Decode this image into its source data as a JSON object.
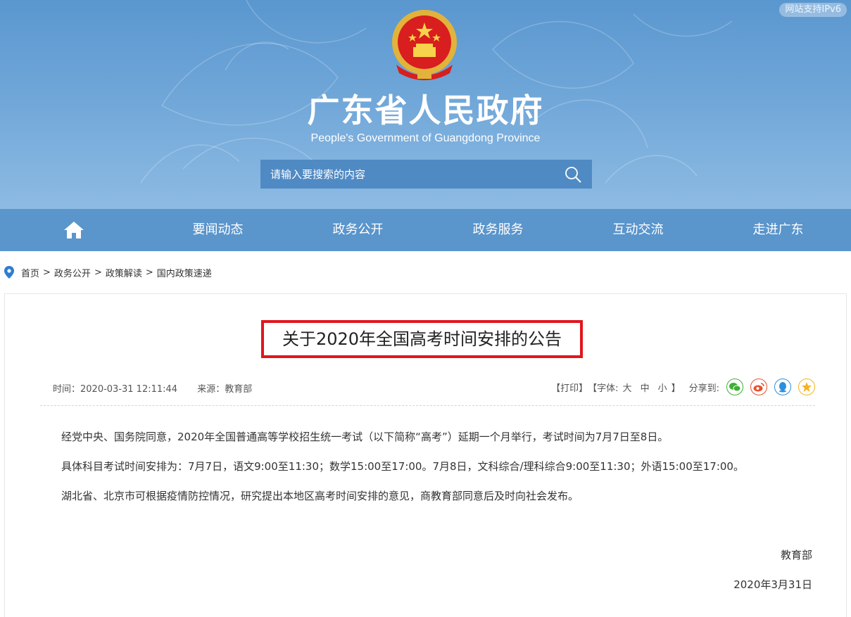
{
  "header": {
    "ipv6_badge": "网站支持IPv6",
    "title": "广东省人民政府",
    "subtitle": "People's Government of Guangdong Province",
    "search_placeholder": "请输入要搜索的内容"
  },
  "nav": {
    "items": [
      "要闻动态",
      "政务公开",
      "政务服务",
      "互动交流",
      "走进广东"
    ]
  },
  "breadcrumb": {
    "items": [
      "首页",
      "政务公开",
      "政策解读",
      "国内政策速递"
    ],
    "separator": ">"
  },
  "article": {
    "title": "关于2020年全国高考时间安排的公告",
    "time_label": "时间：2020-03-31 12:11:44",
    "source_label": "来源：教育部",
    "print": "【打印】",
    "font_open": "【字体:",
    "font_large": "大",
    "font_medium": "中",
    "font_small": "小",
    "font_close": "】",
    "share_label": "分享到:",
    "paragraphs": [
      "经党中央、国务院同意，2020年全国普通高等学校招生统一考试（以下简称“高考”）延期一个月举行，考试时间为7月7日至8日。",
      "具体科目考试时间安排为：7月7日，语文9:00至11:30；数学15:00至17:00。7月8日，文科综合/理科综合9:00至11:30；外语15:00至17:00。",
      "湖北省、北京市可根据疫情防控情况，研究提出本地区高考时间安排的意见，商教育部同意后及时向社会发布。"
    ],
    "signature_org": "教育部",
    "signature_date": "2020年3月31日"
  },
  "icons": {
    "home": "home-icon",
    "search": "search-icon",
    "location": "location-pin-icon",
    "share": [
      "wechat-icon",
      "weibo-icon",
      "qq-icon",
      "qzone-icon"
    ]
  },
  "colors": {
    "header_blue": "#5a97cf",
    "nav_blue": "#5a95cc",
    "title_border": "#e0161d",
    "wechat": "#3cb034",
    "weibo": "#e6512f",
    "qq": "#2d8fdb",
    "qzone": "#f4b320"
  }
}
